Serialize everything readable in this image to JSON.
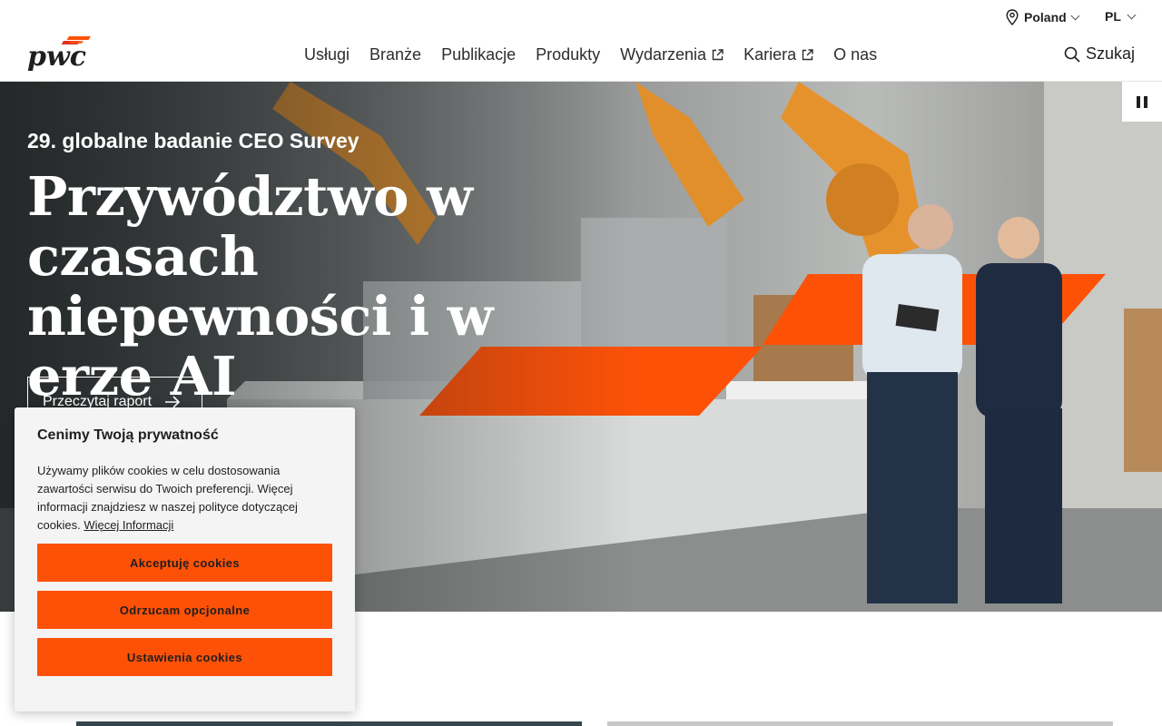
{
  "utility": {
    "region_label": "Poland",
    "language_label": "PL"
  },
  "header": {
    "logo_text": "pwc",
    "nav": [
      {
        "label": "Usługi",
        "external": false
      },
      {
        "label": "Branże",
        "external": false
      },
      {
        "label": "Publikacje",
        "external": false
      },
      {
        "label": "Produkty",
        "external": false
      },
      {
        "label": "Wydarzenia",
        "external": true
      },
      {
        "label": "Kariera",
        "external": true
      },
      {
        "label": "O nas",
        "external": false
      }
    ],
    "search_label": "Szukaj"
  },
  "hero": {
    "eyebrow": "29. globalne badanie CEO Survey",
    "headline": "Przywództwo w czasach niepewności i w erze AI",
    "cta_label": "Przeczytaj raport"
  },
  "cookie_banner": {
    "title": "Cenimy Twoją prywatność",
    "body": "Używamy plików cookies w celu dostosowania zawartości serwisu do Twoich preferencji. Więcej informacji znajdziesz w naszej polityce dotyczącej cookies. ",
    "more_link": "Więcej Informacji",
    "accept_label": "Akceptuję cookies",
    "reject_label": "Odrzucam opcjonalne",
    "settings_label": "Ustawienia cookies"
  },
  "colors": {
    "brand_orange": "#fd5108",
    "text_dark": "#1f1f1f"
  }
}
